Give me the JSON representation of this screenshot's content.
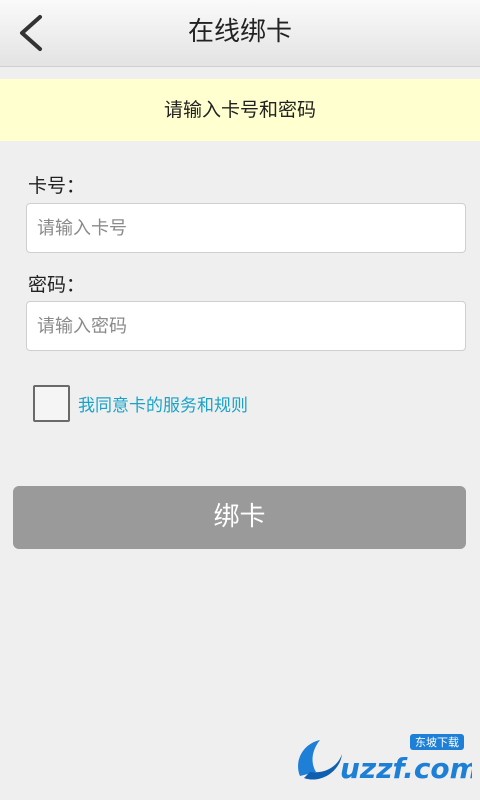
{
  "header": {
    "title": "在线绑卡",
    "back_icon": "chevron-left-icon"
  },
  "notice": {
    "text": "请输入卡号和密码"
  },
  "form": {
    "card_label": "卡号：",
    "card_placeholder": "请输入卡号",
    "card_value": "",
    "password_label": "密码：",
    "password_placeholder": "请输入密码",
    "password_value": "",
    "agree_text": "我同意卡的服务和规则",
    "agree_checked": false
  },
  "submit": {
    "label": "绑卡"
  },
  "watermark": {
    "brand": "uzzf.com",
    "tag": "东坡下载"
  },
  "colors": {
    "notice_bg": "#ffffcf",
    "link": "#1aa3c8",
    "button_bg": "#9a9a9a"
  }
}
